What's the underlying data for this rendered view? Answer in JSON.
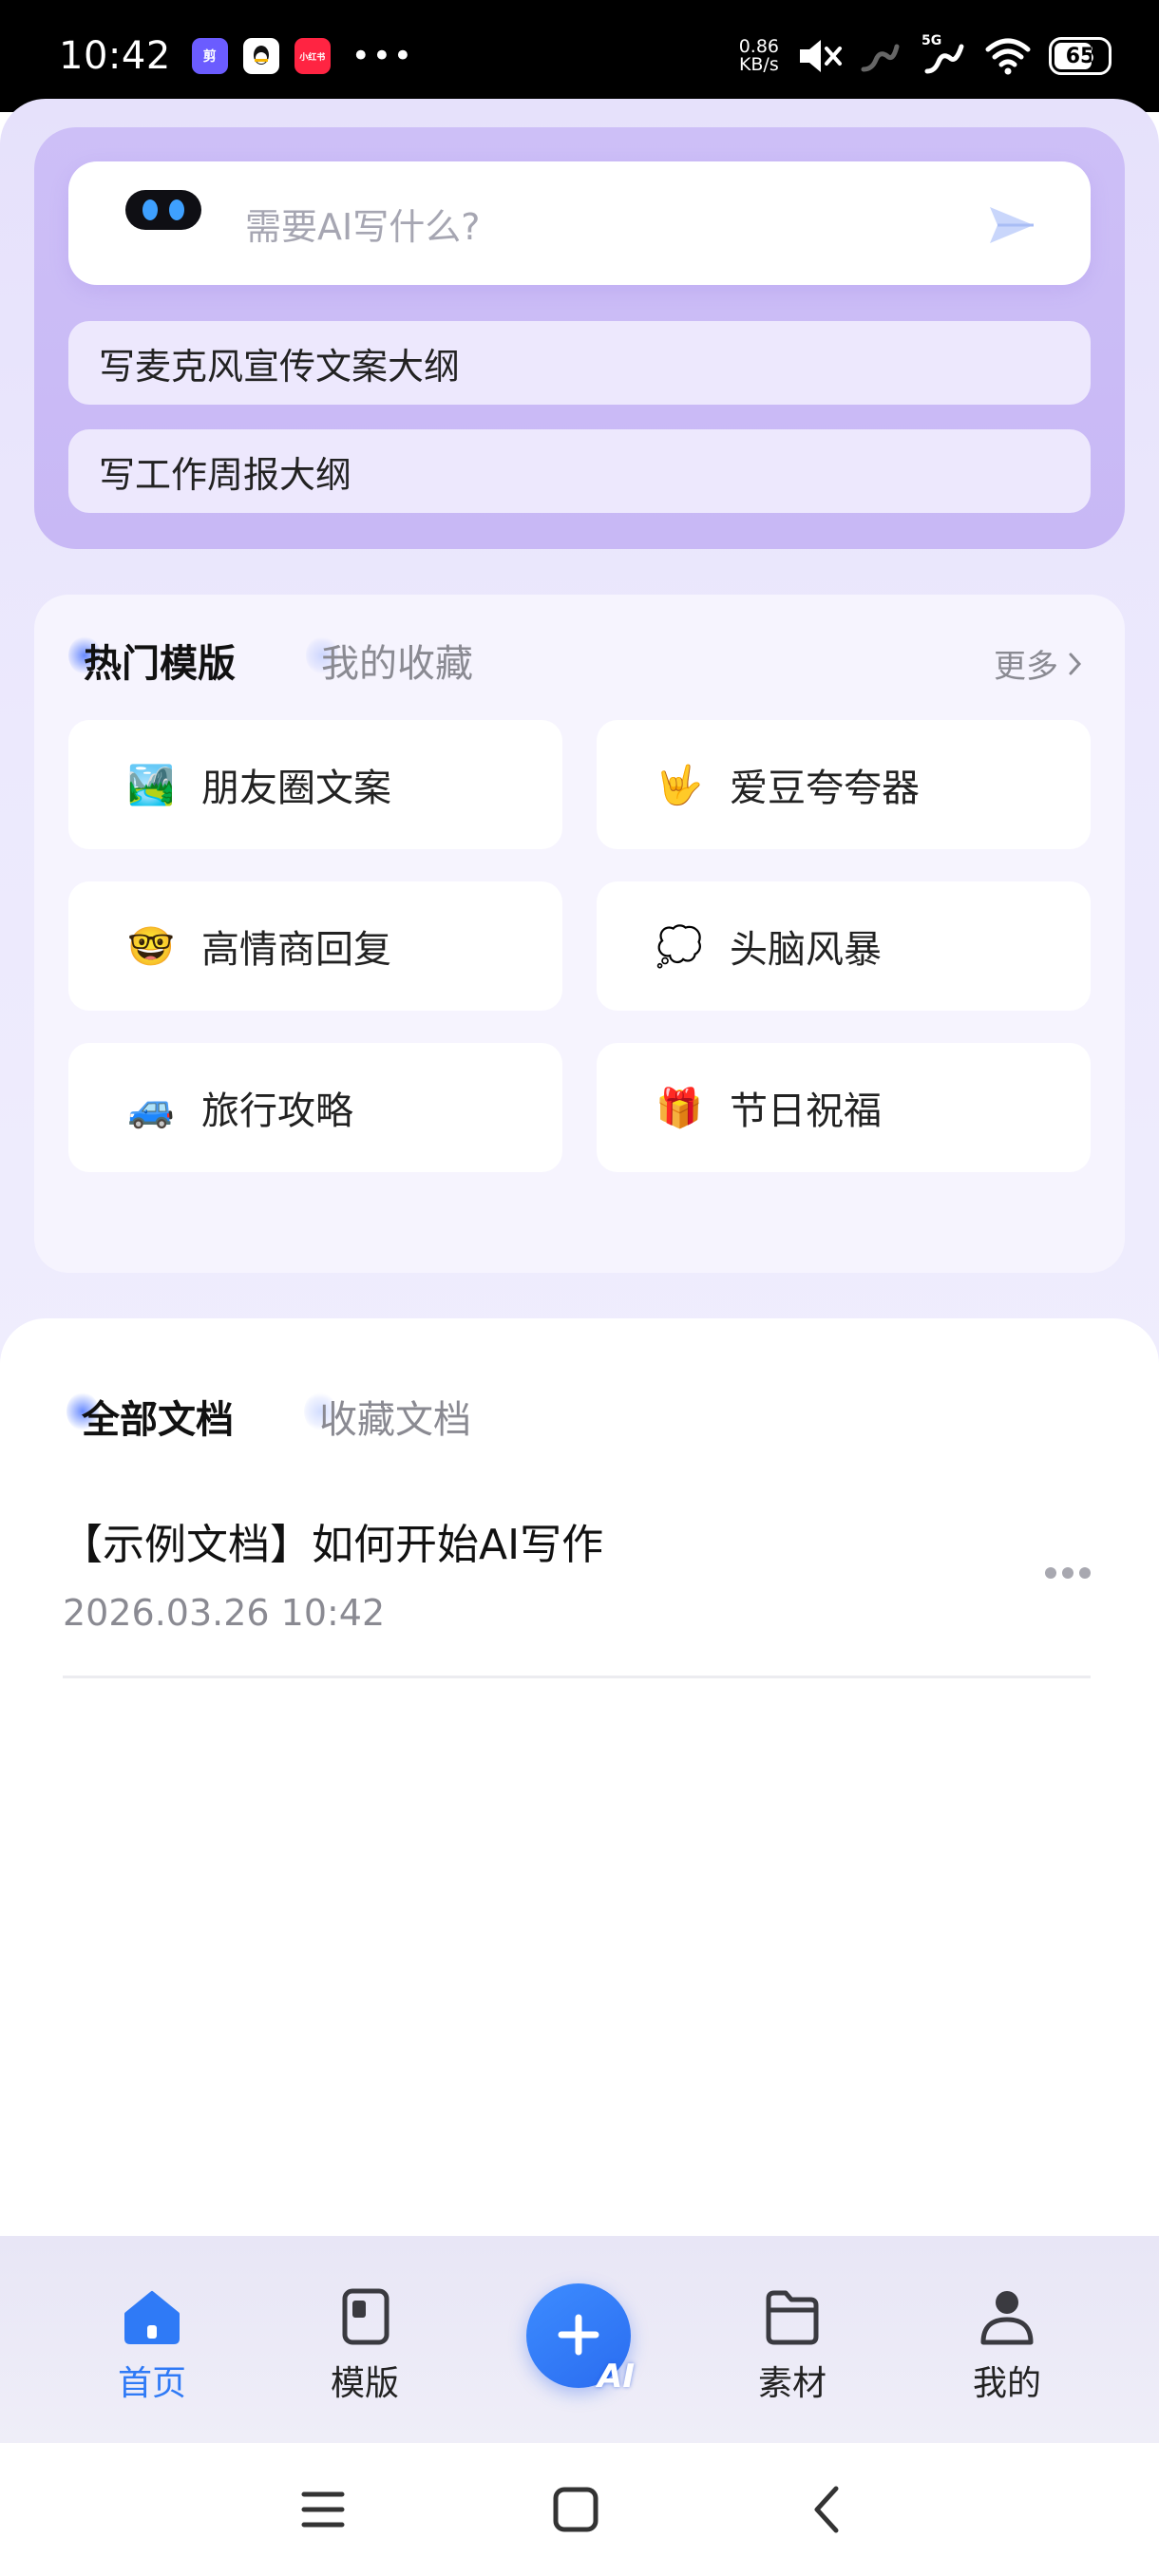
{
  "status_bar": {
    "time": "10:42",
    "notifications": [
      {
        "name": "app-notification-icon-1",
        "label": "剪",
        "bg": "#6b5cff"
      },
      {
        "name": "qq-icon",
        "label": "",
        "bg": "#ffffff"
      },
      {
        "name": "xiaohongshu-icon",
        "label": "小红书",
        "bg": "#ff2442"
      }
    ],
    "more_dots": "•••",
    "net_speed_value": "0.86",
    "net_speed_unit": "KB/s",
    "signal_label": "5G",
    "battery": "65"
  },
  "ai_panel": {
    "placeholder": "需要AI写什么?",
    "suggestions": [
      "写麦克风宣传文案大纲",
      "写工作周报大纲"
    ]
  },
  "hot_templates": {
    "tabs": [
      "热门模版",
      "我的收藏"
    ],
    "more": "更多",
    "tiles": [
      {
        "label": "朋友圈文案",
        "emoji": "🏞️"
      },
      {
        "label": "爱豆夸夸器",
        "emoji": "🤟"
      },
      {
        "label": "高情商回复",
        "emoji": "🤓"
      },
      {
        "label": "头脑风暴",
        "emoji": "💭"
      },
      {
        "label": "旅行攻略",
        "emoji": "🚙"
      },
      {
        "label": "节日祝福",
        "emoji": "🎁"
      }
    ]
  },
  "documents": {
    "tabs": [
      "全部文档",
      "收藏文档"
    ],
    "items": [
      {
        "title": "【示例文档】如何开始AI写作",
        "time": "2026.03.26 10:42"
      }
    ]
  },
  "bottom_nav": {
    "items": [
      "首页",
      "模版",
      "素材",
      "我的"
    ],
    "fab_label": "AI"
  },
  "colors": {
    "accent": "#2f7af6",
    "panel": "#cdbff7",
    "background": "#ece9fd"
  }
}
